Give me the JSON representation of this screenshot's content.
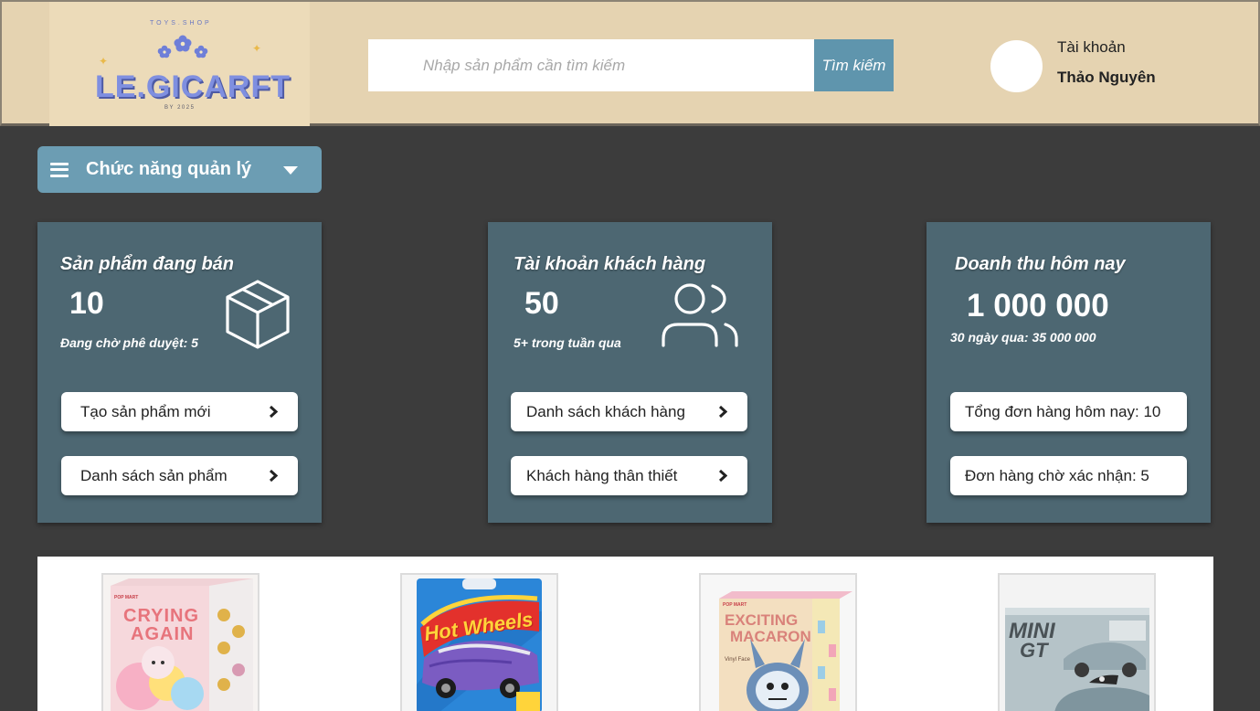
{
  "header": {
    "logo": {
      "tagline": "TOYS.SHOP",
      "name": "LE.GICARFT",
      "year": "BY 2025"
    },
    "search": {
      "placeholder": "Nhập sản phẩm cần tìm kiếm",
      "button_label": "Tìm kiếm"
    },
    "account": {
      "label": "Tài khoản",
      "name": "Thảo Nguyên"
    }
  },
  "menu": {
    "label": "Chức năng quản lý"
  },
  "cards": [
    {
      "title": "Sản phẩm đang bán",
      "value": "10",
      "subtitle": "Đang chờ phê duyệt: 5",
      "icon": "box-icon",
      "buttons": [
        "Tạo sản phẩm mới",
        "Danh sách sản phẩm"
      ]
    },
    {
      "title": "Tài khoản khách hàng",
      "value": "50",
      "subtitle": "5+ trong tuần qua",
      "icon": "users-icon",
      "buttons": [
        "Danh sách khách hàng",
        "Khách hàng thân thiết"
      ]
    },
    {
      "title": "Doanh thu hôm nay",
      "value": "1 000 000",
      "subtitle": "30 ngày qua: 35 000 000",
      "stats": [
        "Tổng đơn hàng hôm nay: 10",
        "Đơn hàng chờ xác nhận: 5"
      ]
    }
  ],
  "products": [
    {
      "box_text": [
        "CRYING",
        "AGAIN"
      ],
      "brand": "POP MART"
    },
    {
      "box_text": [
        "Hot Wheels"
      ]
    },
    {
      "box_text": [
        "EXCITING",
        "MACARON"
      ],
      "box_subtext": "Vinyl Face",
      "brand": "POP MART"
    },
    {
      "box_text": [
        "MINI",
        "GT"
      ]
    }
  ],
  "colors": {
    "header_bg": "#e5d3b1",
    "page_bg": "#3c3c3c",
    "card_bg": "#4d6772",
    "accent": "#6c9db3",
    "search_button": "#5f95ad",
    "logo": "#7f8fe0"
  }
}
